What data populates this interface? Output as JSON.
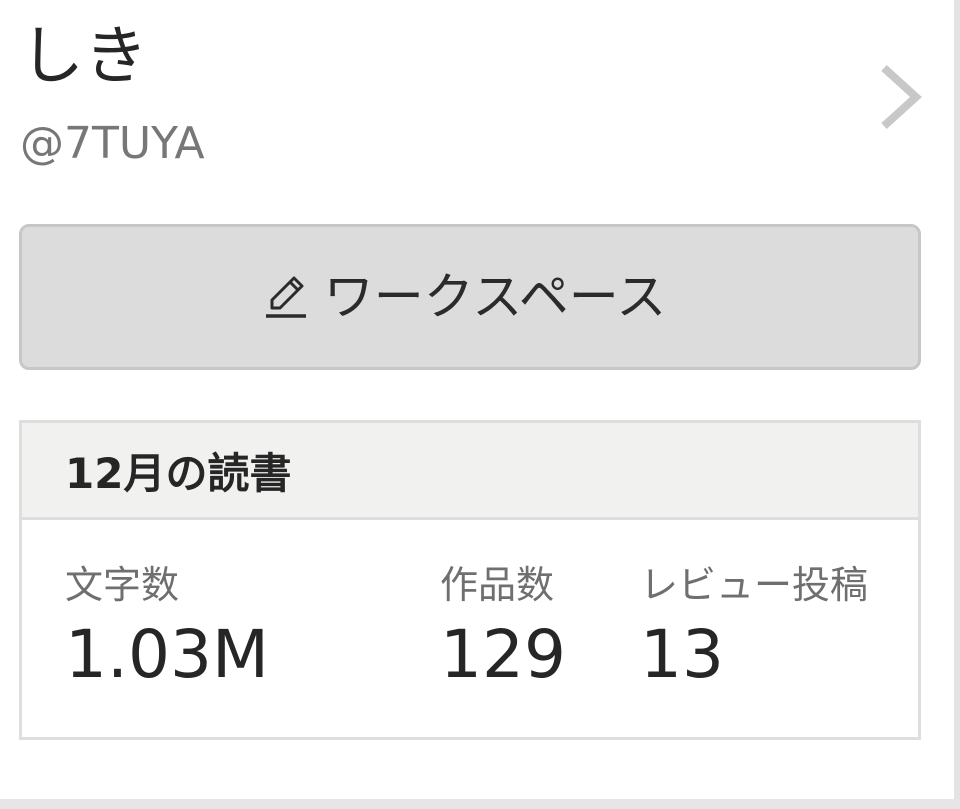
{
  "profile": {
    "name": "しき",
    "handle": "@7TUYA",
    "chevron_icon": "chevron-right-icon"
  },
  "workspace_button": {
    "icon": "pencil-icon",
    "label": "ワークスペース"
  },
  "reading_stats": {
    "title": "12月の読書",
    "items": [
      {
        "label": "文字数",
        "value": "1.03M"
      },
      {
        "label": "作品数",
        "value": "129"
      },
      {
        "label": "レビュー投稿",
        "value": "13"
      }
    ]
  },
  "colors": {
    "button_bg": "#dcdcdc",
    "header_bg": "#f1f1f0",
    "muted_text": "#777777",
    "chevron": "#c8c8c8"
  }
}
